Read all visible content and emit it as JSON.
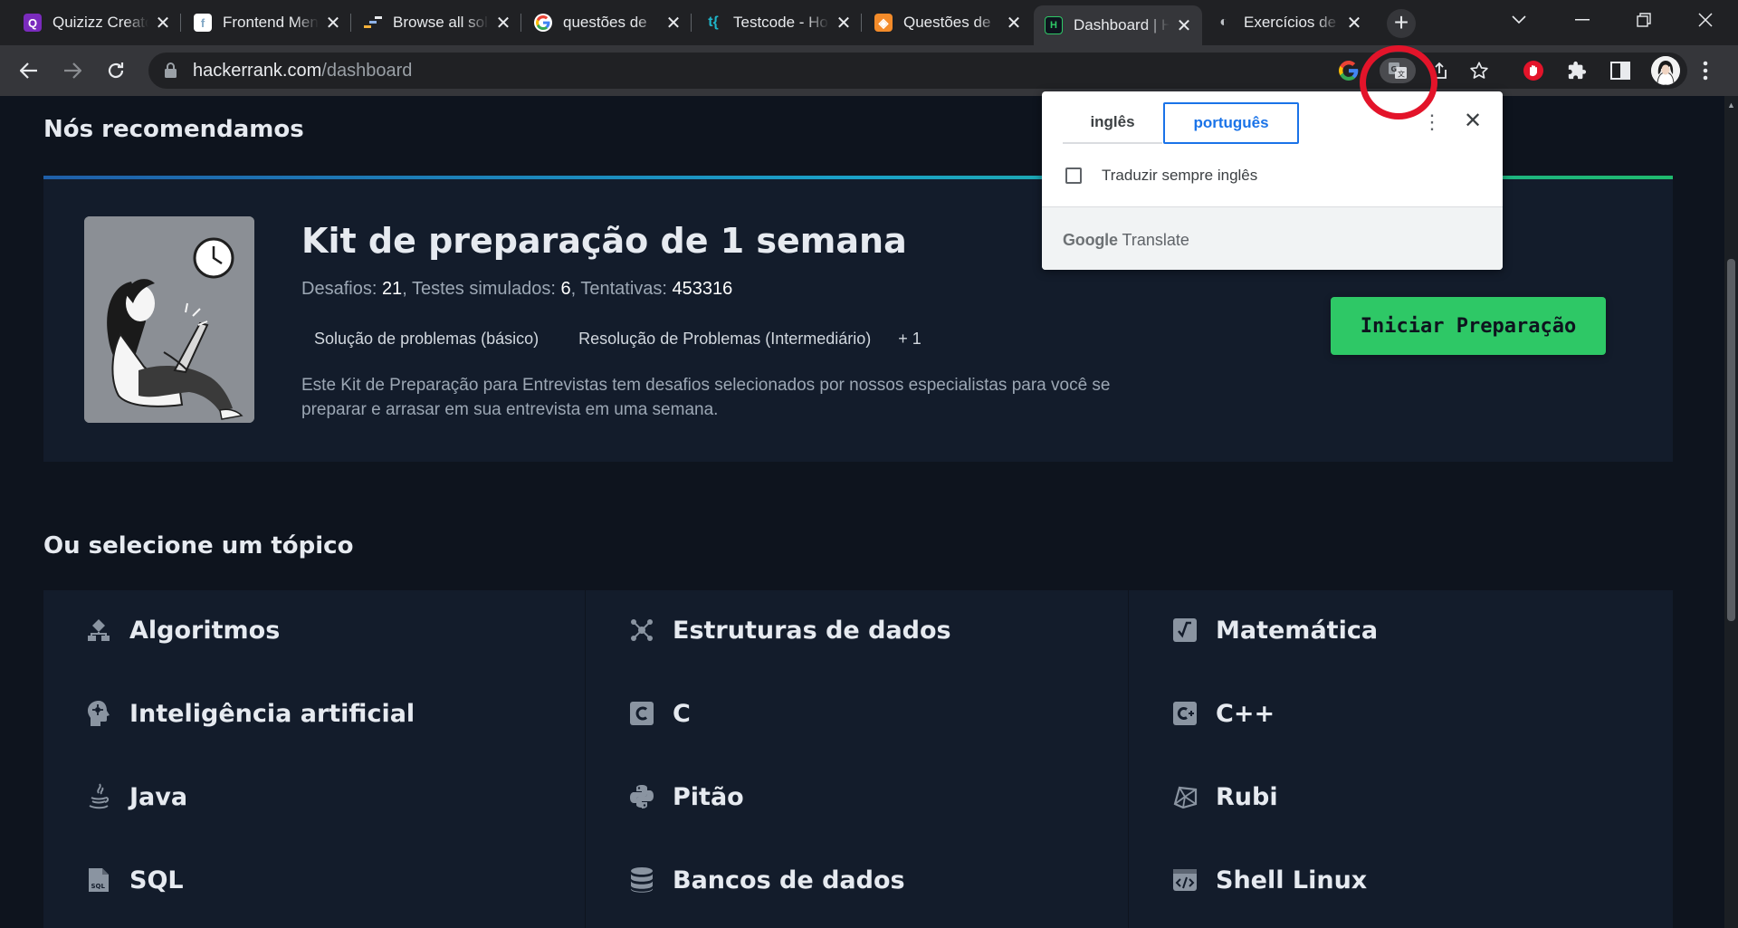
{
  "browser": {
    "tabs": [
      {
        "title": "Quizizz Creator",
        "favicon": "Q",
        "favicon_color": "#7a2bbd"
      },
      {
        "title": "Frontend Mentor",
        "favicon": "f",
        "favicon_color": "#ffffff"
      },
      {
        "title": "Browse all solutions",
        "favicon": "~",
        "favicon_color": "#2b2b2b"
      },
      {
        "title": "questões de",
        "favicon": "G",
        "favicon_color": "#ffffff"
      },
      {
        "title": "Testcode - Home",
        "favicon": "t{",
        "favicon_color": "#0e141e"
      },
      {
        "title": "Questões de",
        "favicon": "◈",
        "favicon_color": "#f38b2a"
      },
      {
        "title": "Dashboard | HackerRank",
        "favicon": "H",
        "favicon_color": "#0e141e"
      },
      {
        "title": "Exercícios de",
        "favicon": "◐",
        "favicon_color": "#202124"
      }
    ],
    "new_tab_label": "+",
    "url_host": "hackerrank.com",
    "url_path": "/dashboard"
  },
  "translate_popup": {
    "source_language": "inglês",
    "target_language": "português",
    "always_translate_label": "Traduzir sempre inglês",
    "brand_google": "Google",
    "brand_translate": "Translate",
    "close_label": "✕",
    "more_label": "⋮"
  },
  "recommend": {
    "heading": "Nós recomendamos",
    "kit_title": "Kit de preparação de 1 semana",
    "stats": {
      "challenges_label": "Desafios:",
      "challenges_value": "21",
      "mock_label": "Testes simulados:",
      "mock_value": "6",
      "attempts_label": "Tentativas:",
      "attempts_value": "453316"
    },
    "tags": [
      "Solução de problemas (básico)",
      "Resolução de Problemas (Intermediário)",
      "+ 1"
    ],
    "description": "Este Kit de Preparação para Entrevistas tem desafios selecionados por nossos especialistas para você se preparar e arrasar em sua entrevista em uma semana.",
    "start_button": "Iniciar Preparação"
  },
  "topics": {
    "heading": "Ou selecione um tópico",
    "items": [
      {
        "label": "Algoritmos",
        "icon": "algorithms-icon"
      },
      {
        "label": "Estruturas de dados",
        "icon": "data-structures-icon"
      },
      {
        "label": "Matemática",
        "icon": "math-icon"
      },
      {
        "label": "Inteligência artificial",
        "icon": "ai-icon"
      },
      {
        "label": "C",
        "icon": "c-icon"
      },
      {
        "label": "C++",
        "icon": "cpp-icon"
      },
      {
        "label": "Java",
        "icon": "java-icon"
      },
      {
        "label": "Pitão",
        "icon": "python-icon"
      },
      {
        "label": "Rubi",
        "icon": "ruby-icon"
      },
      {
        "label": "SQL",
        "icon": "sql-icon"
      },
      {
        "label": "Bancos de dados",
        "icon": "database-icon"
      },
      {
        "label": "Shell Linux",
        "icon": "shell-icon"
      }
    ]
  }
}
